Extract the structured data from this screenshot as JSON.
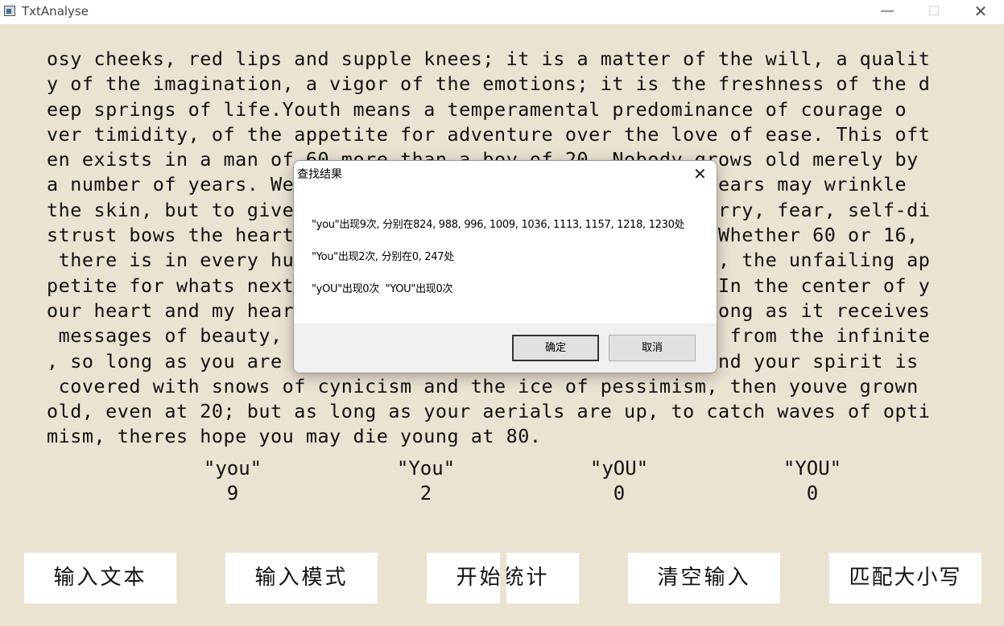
{
  "window": {
    "title": "TxtAnalyse",
    "minimize_glyph": "—",
    "maximize_glyph": "☐",
    "close_glyph": "✕"
  },
  "text_lines": [
    "osy cheeks, red lips and supple knees; it is a matter of the will, a qualit",
    "y of the imagination, a vigor of the emotions; it is the freshness of the d",
    "eep springs of life.Youth means a temperamental predominance of courage o",
    "ver timidity, of the appetite for adventure over the love of ease. This oft",
    "en exists in a man of 60 more than a boy of 20. Nobody grows old merely by",
    "a number of years. We grow old by deserting our ideals. Years may wrinkle",
    "the skin, but to give up enthusiasm wrinkles the soul. Worry, fear, self-di",
    "strust bows the heart and turns the spirit back to dust. Whether 60 or 16,",
    " there is in every human beings heart the lure of wonders, the unfailing ap",
    "petite for whats next and the joy of the game of living. In the center of y",
    "our heart and my heart, there is a wireless station; so long as it receives",
    " messages of beauty, hope, courage and power from man and from the infinite",
    ", so long as you are young. When your aerials are down, and your spirit is",
    " covered with snows of cynicism and the ice of pessimism, then youve grown",
    "old, even at 20; but as long as your aerials are up, to catch waves of opti",
    "mism, theres hope you may die young at 80."
  ],
  "stats": [
    {
      "label": "\"you\"",
      "count": "9"
    },
    {
      "label": "\"You\"",
      "count": "2"
    },
    {
      "label": "\"yOU\"",
      "count": "0"
    },
    {
      "label": "\"YOU\"",
      "count": "0"
    }
  ],
  "buttons": {
    "input_text": "输入文本",
    "input_pattern": "输入模式",
    "start_stats": "开始统计",
    "clear_input": "清空输入",
    "match_case": "匹配大小写"
  },
  "dialog": {
    "title": "查找结果",
    "close_glyph": "✕",
    "line1": "\"you\"出现9次, 分别在824, 988, 996, 1009, 1036, 1113, 1157, 1218, 1230处",
    "line2": "\"You\"出现2次, 分别在0, 247处",
    "line3": "\"yOU\"出现0次  \"YOU\"出现0次",
    "ok_label": "确定",
    "cancel_label": "取消"
  }
}
